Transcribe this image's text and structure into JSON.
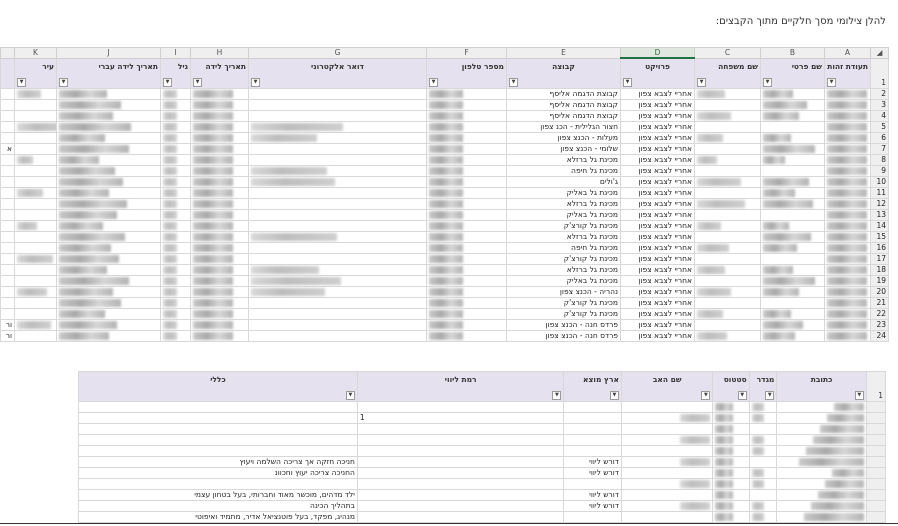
{
  "caption": "להלן צילומי מסך חלקיים מתוך הקבצים:",
  "sheet1": {
    "col_letters": [
      "K",
      "J",
      "I",
      "H",
      "G",
      "F",
      "E",
      "D",
      "C",
      "B",
      "A"
    ],
    "selected_col": "D",
    "headers": {
      "K": "עיר",
      "J": "תאריך לידה עברי",
      "I": "גיל",
      "H": "תאריך לידה",
      "G": "דואר אלקטרוני",
      "F": "מספר טלפון",
      "E": "קבוצה",
      "D": "פרויקט",
      "C": "שם משפחה",
      "B": "שם פרטי",
      "A": "תעודת זהות"
    },
    "rows": [
      {
        "n": "2",
        "group": "קבוצת הדגמה אליסף",
        "project": "אחריי לצבא צפון"
      },
      {
        "n": "3",
        "group": "קבוצת הדגמה אליסף",
        "project": "אחריי לצבא צפון"
      },
      {
        "n": "4",
        "group": "קבוצת הדגמה אליסף",
        "project": "אחריי לצבא צפון"
      },
      {
        "n": "5",
        "group": "חצור הגלילית - הכנ צפון",
        "project": "אחריי לצבא צפון"
      },
      {
        "n": "6",
        "group": "מעלות - הכנצ צפון",
        "project": "אחריי לצבא צפון"
      },
      {
        "n": "7",
        "group": "שלומי - הכנצ צפון",
        "project": "אחריי לצבא צפון"
      },
      {
        "n": "8",
        "group": "מכינת גל ברזלא",
        "project": "אחריי לצבא צפון"
      },
      {
        "n": "9",
        "group": "מכינת גל חיפה",
        "project": "אחריי לצבא צפון"
      },
      {
        "n": "10",
        "group": "ג'ולים",
        "project": "אחריי לצבא צפון"
      },
      {
        "n": "11",
        "group": "מכינת גל באליק",
        "project": "אחריי לצבא צפון"
      },
      {
        "n": "12",
        "group": "מכינת גל ברזלא",
        "project": "אחריי לצבא צפון"
      },
      {
        "n": "13",
        "group": "מכינת גל באליק",
        "project": "אחריי לצבא צפון"
      },
      {
        "n": "14",
        "group": "מכינת גל קורצ'ק",
        "project": "אחריי לצבא צפון"
      },
      {
        "n": "15",
        "group": "מכינת גל ברזלא",
        "project": "אחריי לצבא צפון"
      },
      {
        "n": "16",
        "group": "מכינת גל חיפה",
        "project": "אחריי לצבא צפון"
      },
      {
        "n": "17",
        "group": "מכינת גל קורצ'ק",
        "project": "אחריי לצבא צפון"
      },
      {
        "n": "18",
        "group": "מכינת גל ברזלא",
        "project": "אחריי לצבא צפון"
      },
      {
        "n": "19",
        "group": "מכינת גל באליק",
        "project": "אחריי לצבא צפון"
      },
      {
        "n": "20",
        "group": "נהריה - הכנצ צפון",
        "project": "אחריי לצבא צפון"
      },
      {
        "n": "21",
        "group": "מכינת גל קורצ'ק",
        "project": "אחריי לצבא צפון"
      },
      {
        "n": "22",
        "group": "מכינת גל קורצ'ק",
        "project": "אחריי לצבא צפון"
      },
      {
        "n": "23",
        "group": "פרדס חנה - הכנצ צפון",
        "project": "אחריי לצבא צפון"
      },
      {
        "n": "24",
        "group": "פרדס חנה - הכנצ צפון",
        "project": "אחריי לצבא צפון"
      }
    ],
    "header_row_num": "1",
    "k_col_partials": {
      "7": "א",
      "23": "ור",
      "24": "ור"
    }
  },
  "sheet2": {
    "headers": {
      "general": "כללי",
      "mentoring": "רמת ליווי",
      "origin": "ארץ מוצא",
      "father": "שם האב",
      "status": "סטטוס",
      "gender": "מגדר",
      "address": "כתובת"
    },
    "header_row_num": "1",
    "rows": [
      {
        "general": "",
        "mentoring": "",
        "origin": ""
      },
      {
        "general": "",
        "mentoring": "1",
        "origin": ""
      },
      {
        "general": "",
        "mentoring": "",
        "origin": ""
      },
      {
        "general": "",
        "mentoring": "",
        "origin": ""
      },
      {
        "general": "",
        "mentoring": "",
        "origin": ""
      },
      {
        "general": "חניכה חזקה אך צריכה השלמה ויעוץ",
        "mentoring": "",
        "origin": "דורש ליווי"
      },
      {
        "general": "החניכה צריכה יעוץ וחכוונ",
        "mentoring": "",
        "origin": "דורש ליווי"
      },
      {
        "general": "",
        "mentoring": "",
        "origin": ""
      },
      {
        "general": "ילד מדהים, מוכשר מאוד וחברותי, בעל בטחון עצמי",
        "mentoring": "",
        "origin": "דורש ליווי"
      },
      {
        "general": "בתהליך הכינה",
        "mentoring": "",
        "origin": "דורש ליווי"
      },
      {
        "general": "מנהיג, מפקד, בעל פוטנציאל אדיר, מתמיד ואיפוטי",
        "mentoring": "",
        "origin": ""
      }
    ]
  }
}
